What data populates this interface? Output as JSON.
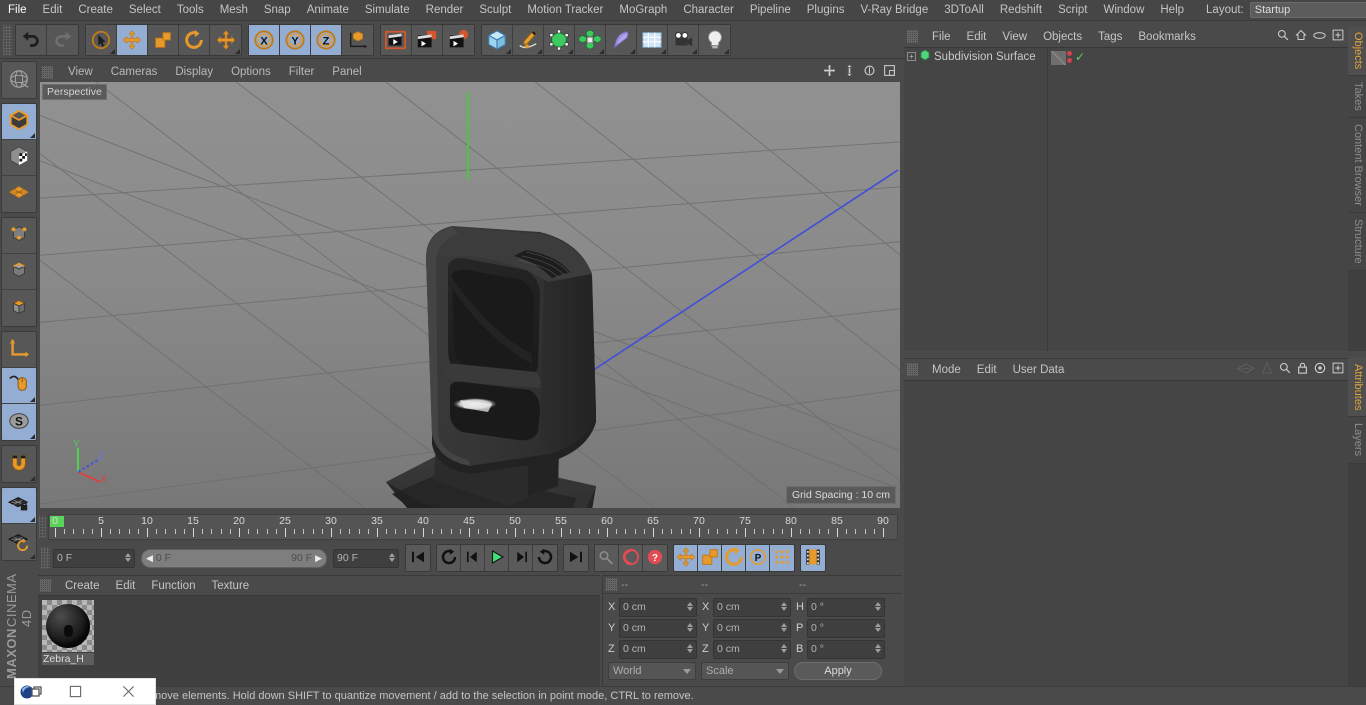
{
  "app": {
    "brand_line1": "MAXON",
    "brand_line2": "CINEMA 4D"
  },
  "menu": {
    "items": [
      "File",
      "Edit",
      "Create",
      "Select",
      "Tools",
      "Mesh",
      "Snap",
      "Animate",
      "Simulate",
      "Render",
      "Sculpt",
      "Motion Tracker",
      "MoGraph",
      "Character",
      "Pipeline",
      "Plugins",
      "V-Ray Bridge",
      "3DToAll",
      "Redshift",
      "Script",
      "Window",
      "Help"
    ],
    "layout_label": "Layout:",
    "layout_value": "Startup",
    "search_icon": "search-icon"
  },
  "toolbar": {
    "groups": [
      {
        "name": "history",
        "buttons": [
          {
            "name": "undo-button",
            "icon": "undo-arrow-icon",
            "active": false,
            "corner": false
          },
          {
            "name": "redo-button",
            "icon": "redo-arrow-icon",
            "active": false,
            "corner": false
          }
        ]
      },
      {
        "name": "tools",
        "buttons": [
          {
            "name": "live-selection-tool",
            "icon": "cursor-circle-icon",
            "active": false,
            "corner": true
          },
          {
            "name": "move-tool",
            "icon": "move-arrows-icon",
            "active": true,
            "corner": false
          },
          {
            "name": "scale-tool",
            "icon": "scale-box-icon",
            "active": false,
            "corner": false
          },
          {
            "name": "rotate-tool",
            "icon": "rotate-arc-icon",
            "active": false,
            "corner": false
          },
          {
            "name": "transform-tool",
            "icon": "move-arrows-icon",
            "active": false,
            "corner": true
          }
        ]
      },
      {
        "name": "axis-locks",
        "buttons": [
          {
            "name": "lock-x-axis-button",
            "icon": "x-axis-icon",
            "active": true,
            "corner": false
          },
          {
            "name": "lock-y-axis-button",
            "icon": "y-axis-icon",
            "active": true,
            "corner": false
          },
          {
            "name": "lock-z-axis-button",
            "icon": "z-axis-icon",
            "active": true,
            "corner": false
          },
          {
            "name": "world-coordinate-system-button",
            "icon": "world-axis-cube-icon",
            "active": false,
            "corner": false
          }
        ]
      },
      {
        "name": "render",
        "buttons": [
          {
            "name": "render-view-button",
            "icon": "clapper-frame-icon",
            "active": false,
            "corner": false
          },
          {
            "name": "render-to-picture-viewer-button",
            "icon": "clapper-picture-icon",
            "active": false,
            "corner": false
          },
          {
            "name": "render-settings-button",
            "icon": "clapper-gear-icon",
            "active": false,
            "corner": false
          }
        ]
      },
      {
        "name": "objects",
        "buttons": [
          {
            "name": "add-cube-button",
            "icon": "blue-cube-icon",
            "active": false,
            "corner": true
          },
          {
            "name": "add-spline-button",
            "icon": "pen-spline-icon",
            "active": false,
            "corner": true
          },
          {
            "name": "add-generator-button",
            "icon": "green-cube-icon",
            "active": false,
            "corner": true
          },
          {
            "name": "add-array-button",
            "icon": "green-cluster-icon",
            "active": false,
            "corner": true
          },
          {
            "name": "add-deformer-button",
            "icon": "bend-deformer-icon",
            "active": false,
            "corner": true
          },
          {
            "name": "add-environment-button",
            "icon": "floor-grid-icon",
            "active": false,
            "corner": true
          },
          {
            "name": "add-camera-button",
            "icon": "camera-icon",
            "active": false,
            "corner": true
          },
          {
            "name": "add-light-button",
            "icon": "light-bulb-icon",
            "active": false,
            "corner": true
          }
        ]
      }
    ]
  },
  "lefttools": {
    "groups": [
      [
        {
          "name": "make-editable-button",
          "icon": "sphere-wire-icon",
          "active": false,
          "corner": false
        }
      ],
      [
        {
          "name": "model-mode-button",
          "icon": "model-cube-icon",
          "active": true,
          "corner": true
        },
        {
          "name": "texture-mode-button",
          "icon": "texture-cube-icon",
          "active": false,
          "corner": false
        },
        {
          "name": "workplane-mode-button",
          "icon": "workplane-grid-icon",
          "active": false,
          "corner": false
        }
      ],
      [
        {
          "name": "points-mode-button",
          "icon": "points-cube-icon",
          "active": false,
          "corner": false
        },
        {
          "name": "edges-mode-button",
          "icon": "edges-cube-icon",
          "active": false,
          "corner": false
        },
        {
          "name": "polygons-mode-button",
          "icon": "polygons-cube-icon",
          "active": false,
          "corner": false
        }
      ],
      [
        {
          "name": "axis-mode-button",
          "icon": "axis-corner-icon",
          "active": false,
          "corner": false
        },
        {
          "name": "viewport-solo-button",
          "icon": "mouse-icon",
          "active": true,
          "corner": true
        },
        {
          "name": "enable-snapping-button",
          "icon": "snap-s-icon",
          "active": true,
          "corner": true
        }
      ],
      [
        {
          "name": "magnet-tool-button",
          "icon": "magnet-icon",
          "active": false,
          "corner": true
        }
      ],
      [
        {
          "name": "lock-workplane-button",
          "icon": "grid-lock-icon",
          "active": true,
          "corner": true
        },
        {
          "name": "planar-workplane-button",
          "icon": "grid-rotate-icon",
          "active": false,
          "corner": true
        }
      ]
    ]
  },
  "viewport": {
    "menu": [
      "View",
      "Cameras",
      "Display",
      "Options",
      "Filter",
      "Panel"
    ],
    "nav_icons": [
      "pan-icon",
      "zoom-icon",
      "rotate-icon",
      "maximize-icon"
    ],
    "label": "Perspective",
    "grid_spacing": "Grid Spacing : 10 cm",
    "axis": {
      "x": "X",
      "y": "Y",
      "z": "Z",
      "x_color": "#d8443f",
      "y_color": "#4fd14f",
      "z_color": "#4a58d6"
    },
    "model": "barcode-scanner"
  },
  "timeline": {
    "labels": [
      "0",
      "5",
      "10",
      "15",
      "20",
      "25",
      "30",
      "35",
      "40",
      "45",
      "50",
      "55",
      "60",
      "65",
      "70",
      "75",
      "80",
      "85",
      "90"
    ],
    "current_frame_marker": "0",
    "end_field": "0 F"
  },
  "transport": {
    "current_frame": "0 F",
    "range_start": "0 F",
    "range_end": "90 F",
    "end_frame": "90 F",
    "buttons": [
      {
        "name": "go-to-start-button",
        "icon": "skip-start-icon",
        "active": false
      },
      {
        "name": "play-reverse-loop-button",
        "icon": "loop-icon",
        "active": false
      },
      {
        "name": "step-back-button",
        "icon": "step-back-icon",
        "active": false
      },
      {
        "name": "play-button",
        "icon": "play-icon",
        "active": false
      },
      {
        "name": "step-forward-button",
        "icon": "step-forward-icon",
        "active": false
      },
      {
        "name": "loop-forward-button",
        "icon": "loop-forward-icon",
        "active": false
      },
      {
        "name": "go-to-end-button",
        "icon": "skip-end-icon",
        "active": false
      },
      {
        "name": "record-key-button",
        "icon": "key-icon",
        "active": false
      },
      {
        "name": "autokeying-button",
        "icon": "record-circle-icon",
        "active": false
      },
      {
        "name": "keyframe-selection-button",
        "icon": "record-question-icon",
        "active": false
      },
      {
        "name": "position-key-button",
        "icon": "move-arrows-icon",
        "active": true
      },
      {
        "name": "scale-key-button",
        "icon": "scale-box-icon",
        "active": true
      },
      {
        "name": "rotation-key-button",
        "icon": "rotate-arc-icon",
        "active": true
      },
      {
        "name": "parameter-key-button",
        "icon": "p-circle-icon",
        "active": true
      },
      {
        "name": "point-level-animation-button",
        "icon": "dots-grid-icon",
        "active": true
      },
      {
        "name": "animation-layer-button",
        "icon": "film-strip-icon",
        "active": true
      }
    ]
  },
  "materials": {
    "menu": [
      "Create",
      "Edit",
      "Function",
      "Texture"
    ],
    "items": [
      {
        "name": "Zebra_H"
      }
    ]
  },
  "coordinates": {
    "column_headers": [
      "--",
      "--",
      "--"
    ],
    "rows": [
      {
        "pos_label": "X",
        "pos_value": "0 cm",
        "size_label": "X",
        "size_value": "0 cm",
        "rot_label": "H",
        "rot_value": "0 °"
      },
      {
        "pos_label": "Y",
        "pos_value": "0 cm",
        "size_label": "Y",
        "size_value": "0 cm",
        "rot_label": "P",
        "rot_value": "0 °"
      },
      {
        "pos_label": "Z",
        "pos_value": "0 cm",
        "size_label": "Z",
        "size_value": "0 cm",
        "rot_label": "B",
        "rot_value": "0 °"
      }
    ],
    "system": "World",
    "mode": "Scale",
    "apply": "Apply"
  },
  "objects_panel": {
    "menu": [
      "File",
      "Edit",
      "View",
      "Objects",
      "Tags",
      "Bookmarks"
    ],
    "icons": [
      "search-icon",
      "home-icon",
      "eye-icon",
      "add-layer-icon"
    ],
    "rows": [
      {
        "name": "Subdivision Surface",
        "expandable": true,
        "tags": [
          "layer-swatch",
          "visibility-dots",
          "green-check-tag"
        ]
      }
    ]
  },
  "attributes_panel": {
    "menu": [
      "Mode",
      "Edit",
      "User Data"
    ],
    "icons": [
      "eye-closed-icon",
      "cone-icon",
      "search-icon",
      "lock-icon",
      "target-icon",
      "add-icon"
    ]
  },
  "right_tabs": {
    "top": [
      {
        "label": "Objects",
        "active": true
      },
      {
        "label": "Takes",
        "active": false
      },
      {
        "label": "Content Browser",
        "active": false
      },
      {
        "label": "Structure",
        "active": false
      }
    ],
    "bottom": [
      {
        "label": "Attributes",
        "active": true
      },
      {
        "label": "Layers",
        "active": false
      }
    ]
  },
  "statusbar": {
    "text": "move elements. Hold down SHIFT to quantize movement / add to the selection in point mode, CTRL to remove."
  },
  "window_overlay": {
    "logo_icon": "cinema4d-logo-icon",
    "restore_icon": "restore-window-icon",
    "maximize_icon": "maximize-window-icon",
    "close_icon": "close-window-icon"
  },
  "colors": {
    "panel_bg": "#4a4a4a",
    "accent_blue": "#93aed2",
    "accent_orange": "#e0a33c",
    "viewport_bg": "#878787"
  }
}
